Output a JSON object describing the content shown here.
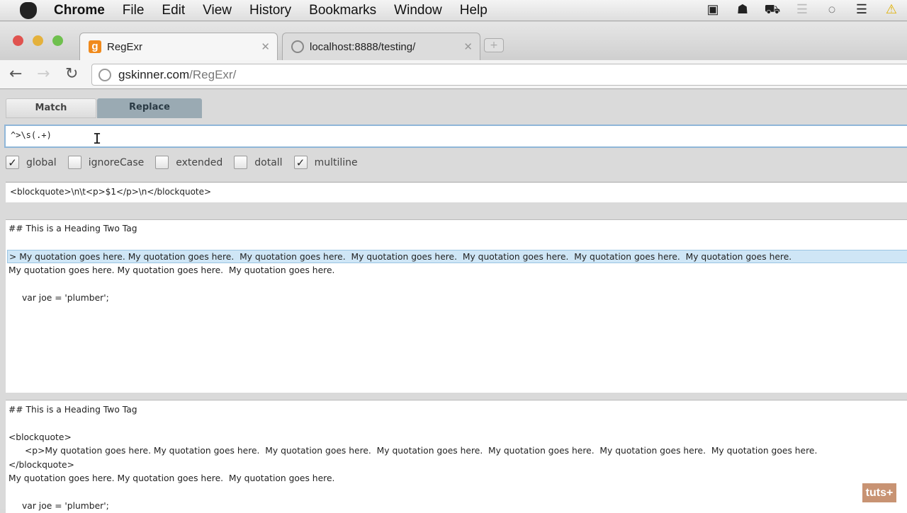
{
  "menubar": {
    "app": "Chrome",
    "items": [
      "File",
      "Edit",
      "View",
      "History",
      "Bookmarks",
      "Window",
      "Help"
    ]
  },
  "tabs": [
    {
      "title": "RegExr",
      "favicon": "g"
    },
    {
      "title": "localhost:8888/testing/"
    }
  ],
  "address": {
    "host": "gskinner.com",
    "path": "/RegExr/"
  },
  "modes": {
    "match": "Match",
    "replace": "Replace"
  },
  "regex": "^>\\s(.+)",
  "flags": [
    {
      "label": "global",
      "checked": true
    },
    {
      "label": "ignoreCase",
      "checked": false
    },
    {
      "label": "extended",
      "checked": false
    },
    {
      "label": "dotall",
      "checked": false
    },
    {
      "label": "multiline",
      "checked": true
    }
  ],
  "replacement": "<blockquote>\\n\\t<p>$1</p>\\n</blockquote>",
  "source": {
    "heading": "## This is a Heading Two Tag",
    "quote": "> My quotation goes here. My quotation goes here.  My quotation goes here.  My quotation goes here.  My quotation goes here.  My quotation goes here.  My quotation goes here.",
    "quote2": "My quotation goes here. My quotation goes here.  My quotation goes here.",
    "code": "var joe = 'plumber';"
  },
  "result": {
    "heading": "## This is a Heading Two Tag",
    "open": "<blockquote>",
    "para": "<p>My quotation goes here. My quotation goes here.  My quotation goes here.  My quotation goes here.  My quotation goes here.  My quotation goes here.  My quotation goes here.",
    "close": "</blockquote>",
    "quote2": "My quotation goes here. My quotation goes here.  My quotation goes here.",
    "code": "var joe = 'plumber';"
  },
  "watermark": "tuts+"
}
